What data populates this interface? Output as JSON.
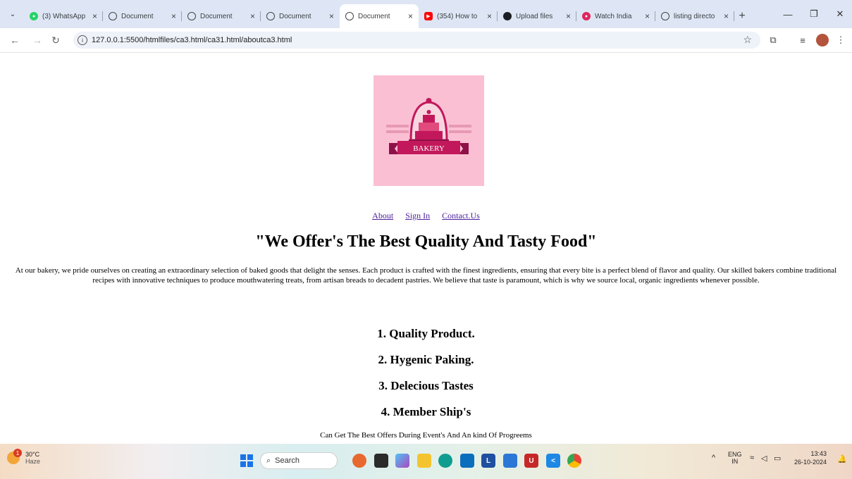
{
  "browser": {
    "tabs": [
      {
        "title": "(3) WhatsApp",
        "favicon": "whatsapp-icon",
        "active": false
      },
      {
        "title": "Document",
        "favicon": "globe-icon",
        "active": false
      },
      {
        "title": "Document",
        "favicon": "globe-icon",
        "active": false
      },
      {
        "title": "Document",
        "favicon": "globe-icon",
        "active": false
      },
      {
        "title": "Document",
        "favicon": "globe-icon",
        "active": true
      },
      {
        "title": "(354) How to",
        "favicon": "youtube-icon",
        "active": false
      },
      {
        "title": "Upload files",
        "favicon": "github-icon",
        "active": false
      },
      {
        "title": "Watch India",
        "favicon": "hotstar-icon",
        "active": false
      },
      {
        "title": "listing directo",
        "favicon": "globe-icon",
        "active": false
      }
    ],
    "url": "127.0.0.1:5500/htmlfiles/ca3.html/ca31.html/aboutca3.html"
  },
  "page": {
    "logo_text": "BAKERY",
    "nav": [
      "About",
      "Sign In",
      "Contact.Us"
    ],
    "headline": "\"We Offer's The Best Quality And Tasty Food\"",
    "paragraph": "At our bakery, we pride ourselves on creating an extraordinary selection of baked goods that delight the senses. Each product is crafted with the finest ingredients, ensuring that every bite is a perfect blend of flavor and quality. Our skilled bakers combine traditional recipes with innovative techniques to produce mouthwatering treats, from artisan breads to decadent pastries. We believe that taste is paramount, which is why we source local, organic ingredients whenever possible.",
    "features": [
      "1. Quality Product.",
      "2. Hygenic Paking.",
      "3. Delecious Tastes",
      "4. Member Ship's"
    ],
    "note": "Can Get The Best Offers During Event's And An kind Of Progreems"
  },
  "taskbar": {
    "weather_temp": "30°C",
    "weather_desc": "Haze",
    "weather_badge": "1",
    "search_label": "Search",
    "lang": "ENG",
    "region": "IN",
    "time": "13:43",
    "date": "26-10-2024"
  },
  "colors": {
    "logo_bg": "#fbbfd3",
    "logo_primary": "#c2185b",
    "link": "#4b1d9a",
    "tabstrip": "#dee6f5"
  }
}
